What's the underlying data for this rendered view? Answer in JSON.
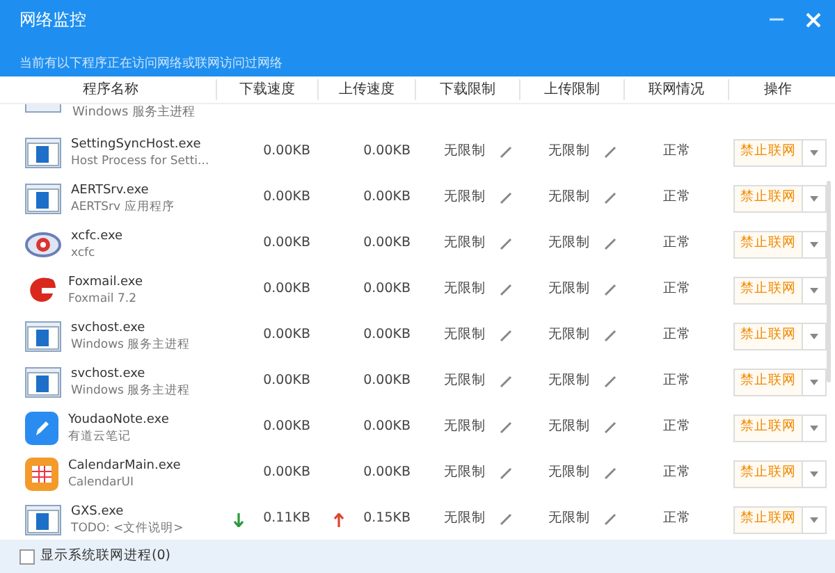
{
  "window": {
    "title": "网络监控",
    "subtitle": "当前有以下程序正在访问网络或联网访问过网络"
  },
  "columns": [
    "程序名称",
    "下载速度",
    "上传速度",
    "下载限制",
    "上传限制",
    "联网情况",
    "操作"
  ],
  "partial_row": {
    "desc": "Windows 服务主进程"
  },
  "rows": [
    {
      "kind": "window",
      "name": "SettingSyncHost.exe",
      "desc": "Host Process for Setti...",
      "down": "0.00KB",
      "up": "0.00KB",
      "down_limit": "无限制",
      "up_limit": "无限制",
      "status": "正常",
      "button": "禁止联网",
      "traffic": false
    },
    {
      "kind": "window",
      "name": "AERTSrv.exe",
      "desc": "AERTSrv 应用程序",
      "down": "0.00KB",
      "up": "0.00KB",
      "down_limit": "无限制",
      "up_limit": "无限制",
      "status": "正常",
      "button": "禁止联网",
      "traffic": false
    },
    {
      "kind": "eye",
      "name": "xcfc.exe",
      "desc": "xcfc",
      "down": "0.00KB",
      "up": "0.00KB",
      "down_limit": "无限制",
      "up_limit": "无限制",
      "status": "正常",
      "button": "禁止联网",
      "traffic": false
    },
    {
      "kind": "swirl",
      "name": "Foxmail.exe",
      "desc": "Foxmail 7.2",
      "down": "0.00KB",
      "up": "0.00KB",
      "down_limit": "无限制",
      "up_limit": "无限制",
      "status": "正常",
      "button": "禁止联网",
      "traffic": false
    },
    {
      "kind": "window",
      "name": "svchost.exe",
      "desc": "Windows 服务主进程",
      "down": "0.00KB",
      "up": "0.00KB",
      "down_limit": "无限制",
      "up_limit": "无限制",
      "status": "正常",
      "button": "禁止联网",
      "traffic": false
    },
    {
      "kind": "window",
      "name": "svchost.exe",
      "desc": "Windows 服务主进程",
      "down": "0.00KB",
      "up": "0.00KB",
      "down_limit": "无限制",
      "up_limit": "无限制",
      "status": "正常",
      "button": "禁止联网",
      "traffic": false
    },
    {
      "kind": "note",
      "name": "YoudaoNote.exe",
      "desc": "有道云笔记",
      "down": "0.00KB",
      "up": "0.00KB",
      "down_limit": "无限制",
      "up_limit": "无限制",
      "status": "正常",
      "button": "禁止联网",
      "traffic": false
    },
    {
      "kind": "calendar",
      "name": "CalendarMain.exe",
      "desc": "CalendarUI",
      "down": "0.00KB",
      "up": "0.00KB",
      "down_limit": "无限制",
      "up_limit": "无限制",
      "status": "正常",
      "button": "禁止联网",
      "traffic": false
    },
    {
      "kind": "window",
      "name": "GXS.exe",
      "desc": "TODO: <文件说明>",
      "down": "0.11KB",
      "up": "0.15KB",
      "down_limit": "无限制",
      "up_limit": "无限制",
      "status": "正常",
      "button": "禁止联网",
      "traffic": true
    }
  ],
  "footer": {
    "label": "显示系统联网进程(0)",
    "checked": false
  }
}
